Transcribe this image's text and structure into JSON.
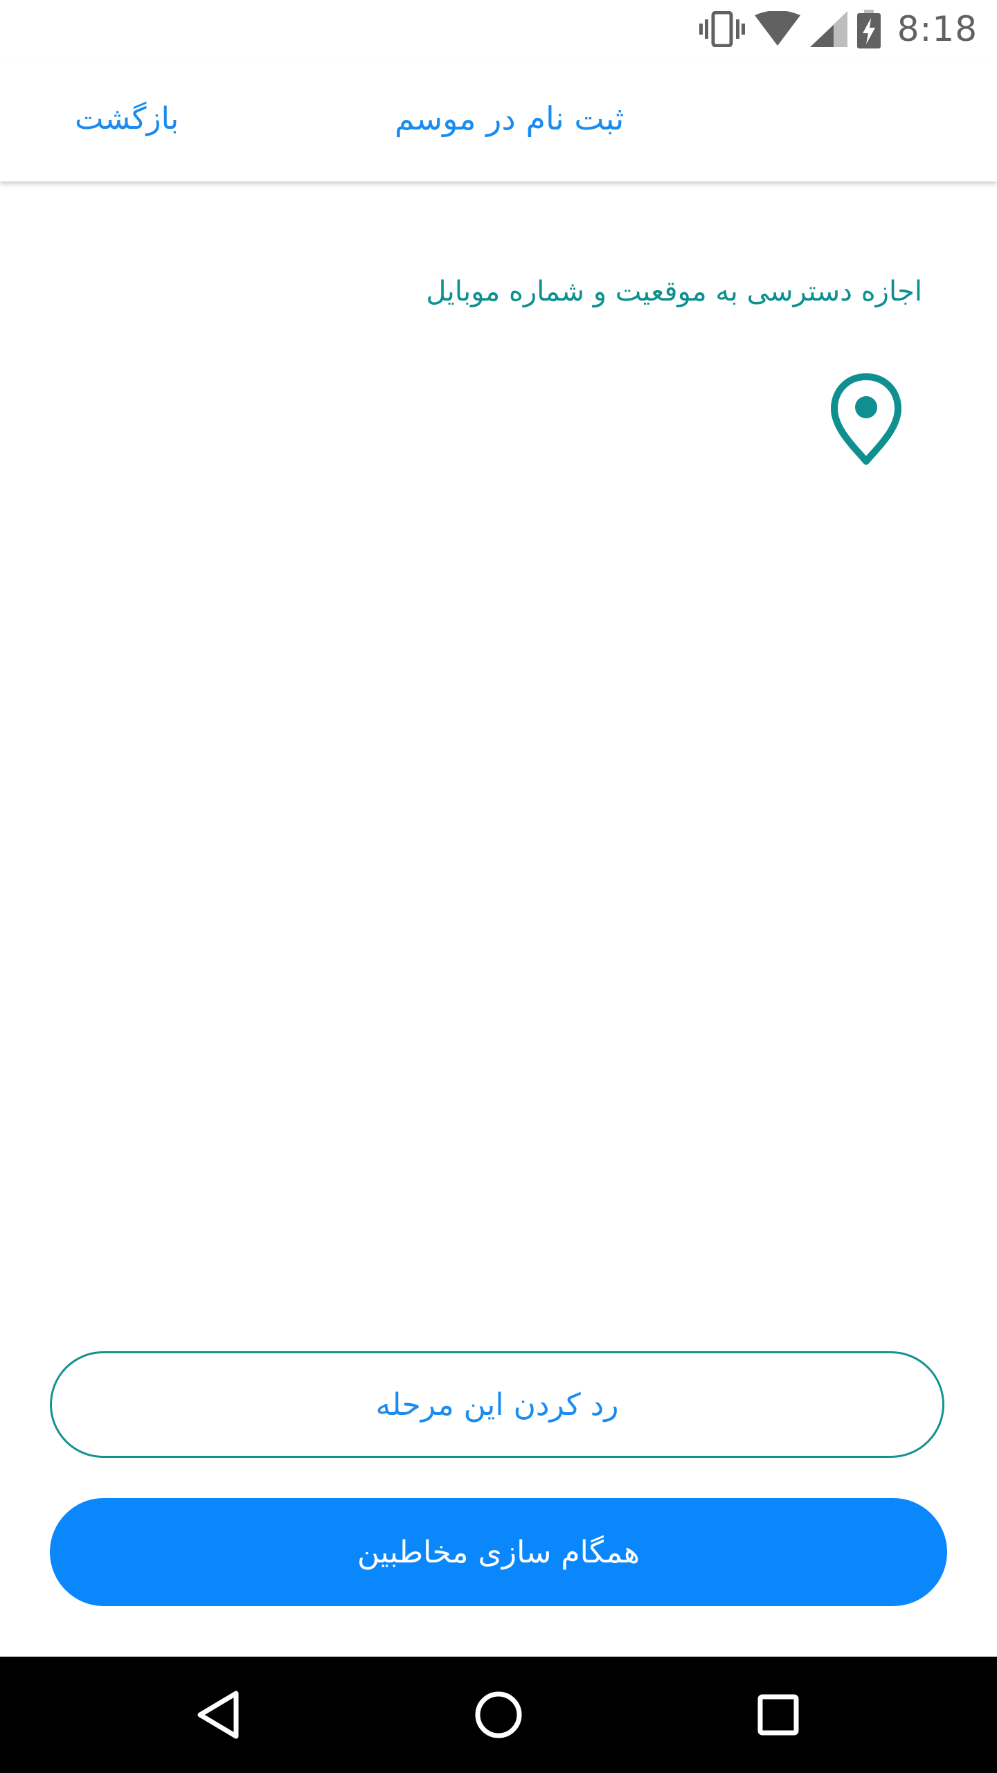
{
  "status_bar": {
    "time": "8:18",
    "icons": [
      "vibrate-icon",
      "wifi-icon",
      "signal-icon",
      "battery-charging-icon"
    ]
  },
  "header": {
    "back_label": "بازگشت",
    "title": "ثبت نام در موسم"
  },
  "content": {
    "permission_text": "اجازه دسترسی به موقعیت و شماره موبایل",
    "icon": "location-pin-icon"
  },
  "actions": {
    "skip_label": "رد کردن این مرحله",
    "sync_label": "همگام سازی مخاطبین"
  },
  "nav_bar": {
    "icons": [
      "back-triangle-icon",
      "home-circle-icon",
      "recents-square-icon"
    ]
  },
  "colors": {
    "accent_blue": "#0a87fa",
    "link_blue": "#1a8cf0",
    "teal": "#0f8f8f",
    "status_gray": "#616161"
  }
}
